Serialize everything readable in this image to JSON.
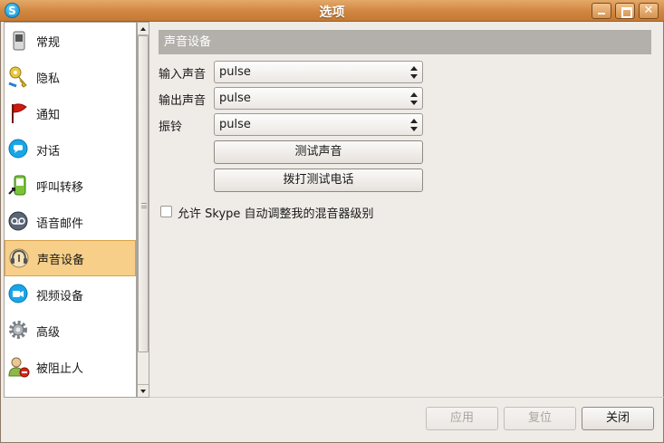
{
  "window": {
    "title": "选项",
    "app_icon_letter": "S"
  },
  "sidebar": {
    "items": [
      {
        "label": "常规",
        "icon": "general-switch-icon"
      },
      {
        "label": "隐私",
        "icon": "privacy-key-icon"
      },
      {
        "label": "通知",
        "icon": "notification-flag-icon"
      },
      {
        "label": "对话",
        "icon": "chat-bubble-icon"
      },
      {
        "label": "呼叫转移",
        "icon": "call-forward-phone-icon"
      },
      {
        "label": "语音邮件",
        "icon": "voicemail-icon"
      },
      {
        "label": "声音设备",
        "icon": "sound-device-headset-icon",
        "selected": true
      },
      {
        "label": "视频设备",
        "icon": "video-camera-icon"
      },
      {
        "label": "高级",
        "icon": "gear-icon"
      },
      {
        "label": "被阻止人",
        "icon": "blocked-user-icon"
      }
    ]
  },
  "main": {
    "section_title": "声音设备",
    "input_label": "输入声音",
    "input_value": "pulse",
    "output_label": "输出声音",
    "output_value": "pulse",
    "ring_label": "振铃",
    "ring_value": "pulse",
    "test_sound_button": "测试声音",
    "test_call_button": "拨打测试电话",
    "auto_adjust_label": "允许 Skype 自动调整我的混音器级别",
    "auto_adjust_checked": false
  },
  "footer": {
    "apply_button": "应用",
    "reset_button": "复位",
    "close_button": "关闭"
  },
  "colors": {
    "titlebar": "#d08640",
    "selected_item": "#f7cf88",
    "section_header": "#b3b0ac"
  }
}
